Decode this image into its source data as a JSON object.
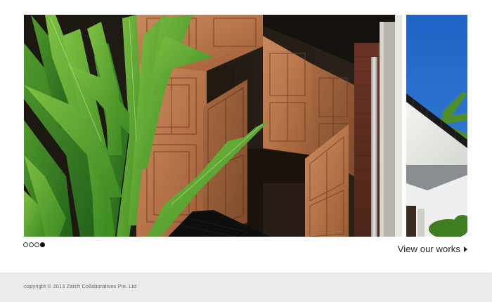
{
  "slideshow": {
    "slides": [
      {
        "subject": "timber-shutter-facade-photo"
      },
      {
        "subject": "white-balcony-sky-photo"
      }
    ],
    "pager": {
      "total": 4,
      "active_index": 3
    }
  },
  "works_link": {
    "label": "View our works",
    "icon": "triangle-right-icon"
  },
  "footer": {
    "copyright": "copyright © 2013 Zarch Collaboratives Pte. Ltd"
  },
  "colors": {
    "page_background": "#ffffff",
    "footer_background": "#ebebeb",
    "text": "#222222",
    "copyright_text": "#6a6a6a"
  }
}
